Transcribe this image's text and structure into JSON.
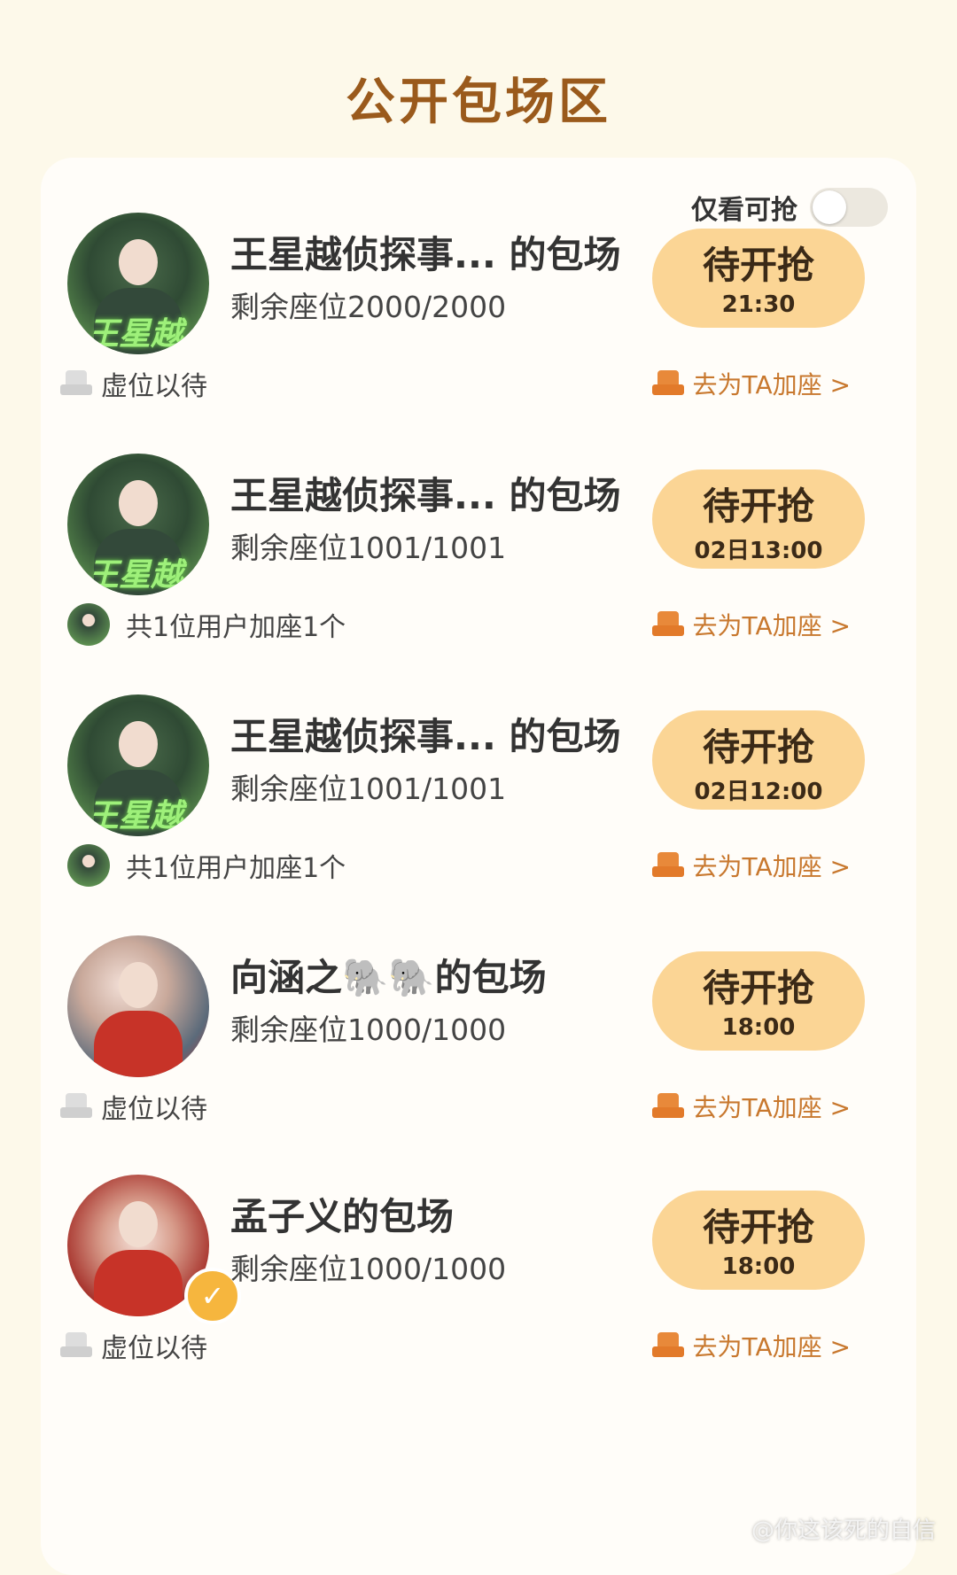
{
  "page": {
    "title": "公开包场区",
    "filter_label": "仅看可抢",
    "filter_on": false,
    "watermark": "@你这该死的自信"
  },
  "rooms": [
    {
      "name": "王星越侦探事...  的包场",
      "seats": "剩余座位2000/2000",
      "button_label": "待开抢",
      "button_time": "21:30",
      "footer_left": "虚位以待",
      "footer_right": "去为TA加座 >",
      "avatar_text": "王星越"
    },
    {
      "name": "王星越侦探事...  的包场",
      "seats": "剩余座位1001/1001",
      "button_label": "待开抢",
      "button_time": "02日13:00",
      "footer_left": "共1位用户加座1个",
      "footer_right": "去为TA加座 >",
      "avatar_text": "王星越"
    },
    {
      "name": "王星越侦探事...  的包场",
      "seats": "剩余座位1001/1001",
      "button_label": "待开抢",
      "button_time": "02日12:00",
      "footer_left": "共1位用户加座1个",
      "footer_right": "去为TA加座 >",
      "avatar_text": "王星越"
    },
    {
      "name": "向涵之🐘🐘的包场",
      "seats": "剩余座位1000/1000",
      "button_label": "待开抢",
      "button_time": "18:00",
      "footer_left": "虚位以待",
      "footer_right": "去为TA加座 >"
    },
    {
      "name": "孟子义的包场",
      "seats": "剩余座位1000/1000",
      "button_label": "待开抢",
      "button_time": "18:00",
      "footer_left": "虚位以待",
      "footer_right": "去为TA加座 >"
    }
  ]
}
